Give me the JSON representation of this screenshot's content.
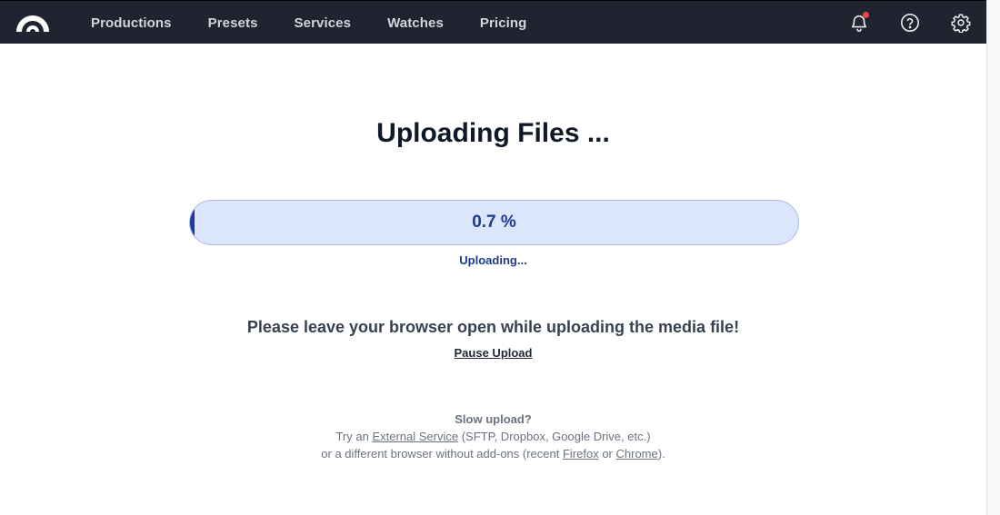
{
  "navbar": {
    "logo": "rainbow-arch-logo",
    "items": [
      {
        "label": "Productions"
      },
      {
        "label": "Presets"
      },
      {
        "label": "Services"
      },
      {
        "label": "Watches"
      },
      {
        "label": "Pricing"
      }
    ],
    "icons": {
      "notifications": "bell-icon",
      "help": "question-circle-icon",
      "settings": "gear-icon"
    },
    "has_unread_notifications": true,
    "colors": {
      "background": "#1f2430",
      "notification_dot": "#ef4444"
    }
  },
  "upload": {
    "title": "Uploading Files ...",
    "progress_percent": 0.7,
    "progress_label": "0.7 %",
    "status": "Uploading...",
    "warning": "Please leave your browser open while uploading the media file!",
    "pause_label": "Pause Upload",
    "colors": {
      "track": "#dbe6fd",
      "fill": "#1e3a9e",
      "text": "#1e3a8a"
    }
  },
  "help": {
    "slow_title": "Slow upload?",
    "line1_prefix": "Try an ",
    "external_service_link": "External Service",
    "line1_suffix": " (SFTP, Dropbox, Google Drive, etc.)",
    "line2_prefix": "or a different browser without add-ons (recent ",
    "firefox_link": "Firefox",
    "line2_middle": " or ",
    "chrome_link": "Chrome",
    "line2_suffix": ")."
  }
}
